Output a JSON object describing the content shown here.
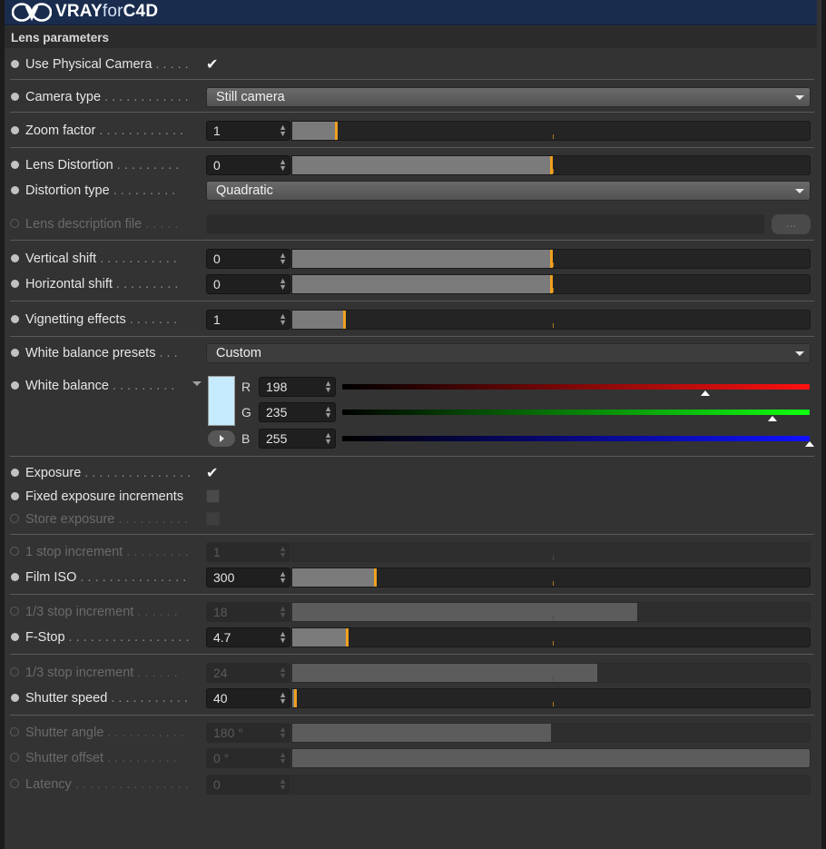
{
  "app": {
    "logo_main": "VRAY",
    "logo_for": "for",
    "logo_end": "C4D"
  },
  "section": {
    "title": "Lens parameters"
  },
  "colors": {
    "accent": "#f0a020",
    "title_bar": "#192c4e",
    "white_balance": "#c6ebff"
  },
  "rows": {
    "use_physical_camera": {
      "label": "Use Physical Camera",
      "dots": " . . . . .",
      "checked": true,
      "check_glyph": "✔"
    },
    "camera_type": {
      "label": "Camera type",
      "dots": " . . . . . . . . . . . .",
      "value": "Still camera"
    },
    "zoom_factor": {
      "label": "Zoom factor",
      "dots": " . . . . . . . . . . . .",
      "value": "1",
      "fill": 0.085
    },
    "lens_distortion": {
      "label": "Lens Distortion",
      "dots": " . . . . . . . . .",
      "value": "0",
      "fill": 0.5
    },
    "distortion_type": {
      "label": "Distortion type",
      "dots": " . . . . . . . . .",
      "value": "Quadratic"
    },
    "lens_description_file": {
      "label": "Lens description file",
      "dots": " . . . . .",
      "button": "..."
    },
    "vertical_shift": {
      "label": "Vertical shift",
      "dots": " . . . . . . . . . . .",
      "value": "0",
      "fill": 0.5
    },
    "horizontal_shift": {
      "label": "Horizontal shift",
      "dots": " . . . . . . . . .",
      "value": "0",
      "fill": 0.5
    },
    "vignetting_effects": {
      "label": "Vignetting effects",
      "dots": " . . . . . . .",
      "value": "1",
      "fill": 0.1
    },
    "white_balance_presets": {
      "label": "White balance presets",
      "dots": " . . .",
      "value": "Custom"
    },
    "white_balance": {
      "label": "White balance",
      "dots": " . . . . . . . . .",
      "r_label": "R",
      "r": "198",
      "r_pos": 0.776,
      "g_label": "G",
      "g": "235",
      "g_pos": 0.92,
      "b_label": "B",
      "b": "255",
      "b_pos": 1.0
    },
    "exposure": {
      "label": "Exposure",
      "dots": " . . . . . . . . . . . . . . .",
      "checked": true,
      "check_glyph": "✔"
    },
    "fixed_exposure_increments": {
      "label": "Fixed exposure increments",
      "dots": "",
      "checked": false
    },
    "store_exposure": {
      "label": "Store exposure",
      "dots": " . . . . . . . . . .",
      "checked": false
    },
    "one_stop_increment": {
      "label": "1 stop increment",
      "dots": " . . . . . . . . .",
      "value": "1",
      "fill": 0.0
    },
    "film_iso": {
      "label": "Film ISO",
      "dots": " . . . . . . . . . . . . . . .",
      "value": "300",
      "fill": 0.16
    },
    "third_stop_increment_a": {
      "label": "1/3 stop increment",
      "dots": " . . . . . .",
      "value": "18",
      "fill": 0.667
    },
    "f_stop": {
      "label": "F-Stop",
      "dots": " . . . . . . . . . . . . . . . . .",
      "value": "4.7",
      "fill": 0.106
    },
    "third_stop_increment_b": {
      "label": "1/3 stop increment",
      "dots": " . . . . . .",
      "value": "24",
      "fill": 0.59
    },
    "shutter_speed": {
      "label": "Shutter speed",
      "dots": " . . . . . . . . . . .",
      "value": "40",
      "fill": 0.005
    },
    "shutter_angle": {
      "label": "Shutter angle",
      "dots": " . . . . . . . . . . .",
      "value": "180 °",
      "fill": 0.5
    },
    "shutter_offset": {
      "label": "Shutter offset",
      "dots": " . . . . . . . . . .",
      "value": "0 °",
      "fill": 1.0
    },
    "latency": {
      "label": "Latency",
      "dots": " . . . . . . . . . . . . . . . .",
      "value": "0",
      "fill": 0.0
    }
  }
}
